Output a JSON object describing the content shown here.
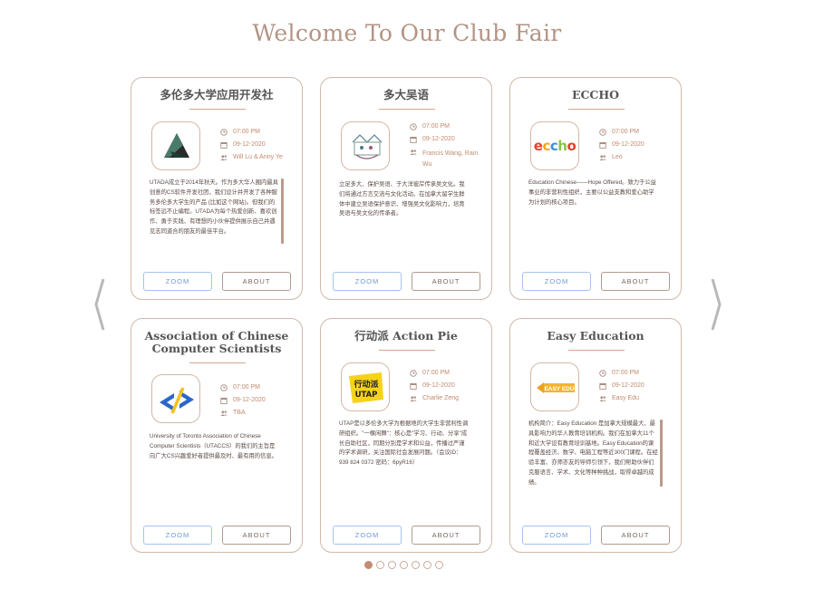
{
  "page": {
    "title": "Welcome To Our Club Fair"
  },
  "buttons": {
    "zoom": "ZOOM",
    "about": "ABOUT"
  },
  "clubs": [
    {
      "name": "多伦多大学应用开发社",
      "time": "07:00 PM",
      "date": "09-12-2020",
      "hosts": "Will Lu & Anny Ye",
      "description": "UTADA成立于2014年秋天。作为多大华人圈内最具创意的CS软件开发社团，我们设计并开发了各种服务多伦多大学生的产品 (比如这个网站)。但我们的标签远不止编程。UTADA为每个热爱创新、喜欢创作、勇于实践、有理想的小伙伴提供展示自己并遇见志同道合的朋友的最佳平台。"
    },
    {
      "name": "多大吴语",
      "time": "07:00 PM",
      "date": "09-12-2020",
      "hosts": "Francis Wang, Rain Wu",
      "description": "立足多大、保护吴语、于大洋彼岸传承吴文化。我们将通过方言交流与文化活动、在加拿大留学生群体中建立吴语保护意识、增强吴文化影响力，培育吴语与吴文化的传承者。"
    },
    {
      "name": "ECCHO",
      "time": "07:00 PM",
      "date": "09-12-2020",
      "hosts": "Leo",
      "logo_text": "eccho",
      "description": "Education Chinese——Hope Offered。致力于公益事业的非营利性组织，主要以公益支教和爱心助学为计划的核心项目。"
    },
    {
      "name": "Association of Chinese Computer Scientists",
      "time": "07:00 PM",
      "date": "09-12-2020",
      "hosts": "TBA",
      "description": "University of Toronto Association of Chinese Computer Scientists（UTACCS）的我们的主旨是向广大CS兴趣爱好者提供最及时、最有用的信息。"
    },
    {
      "name": "行动派 Action Pie",
      "time": "07:00 PM",
      "date": "09-12-2020",
      "hosts": "Charlie Zeng",
      "description": "UTAP是以多伦多大学为根据地的大学生非营利性调研组织。\"一棵闲舞\"：核心是\"学习、行动、分享\"成长自助社区，同期分别是学术和公益，传播过严谨的学术调研，关注国际社会发展问题。（会议ID：939 824 0372 密码：6pyR16）"
    },
    {
      "name": "Easy Education",
      "time": "07:00 PM",
      "date": "09-12-2020",
      "hosts": "Easy Edu",
      "description": "机构简介：Easy Education 是加拿大规模最大、最具影响力的华人教育培训机构。我们在加拿大11个和近大学设有教育培训基地。Easy Education的课程覆盖经济、数学、电脑工程等近300门课程。在经验丰富、亦师亦友的导师引领下，我们帮助伙伴们克服语言、学术、文化等种种挑战，取得卓越的成绩。"
    }
  ],
  "icons": {
    "time": "clock-icon",
    "date": "calendar-icon",
    "hosts": "people-icon",
    "prev": "chevron-left-icon",
    "next": "chevron-right-icon"
  },
  "carousel": {
    "pages": 7,
    "active_page": 1
  },
  "colors": {
    "title": "#b39484",
    "accent": "#c38c72",
    "zoom": "#6d98d6",
    "border": "#d1b8a9"
  }
}
